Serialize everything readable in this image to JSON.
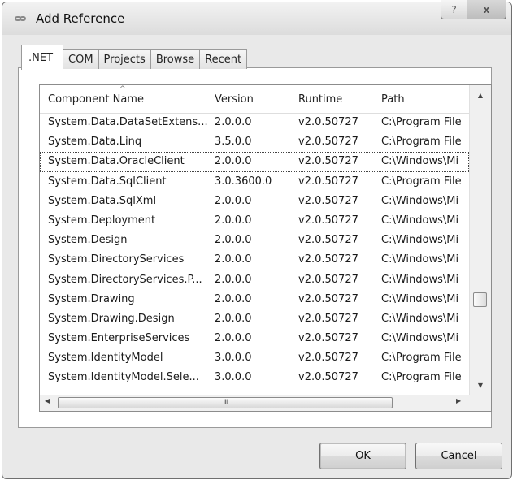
{
  "window": {
    "title": "Add Reference",
    "help_label": "?",
    "close_label": "x"
  },
  "tabs": [
    {
      "label": ".NET",
      "active": true
    },
    {
      "label": "COM",
      "active": false
    },
    {
      "label": "Projects",
      "active": false
    },
    {
      "label": "Browse",
      "active": false
    },
    {
      "label": "Recent",
      "active": false
    }
  ],
  "list": {
    "columns": [
      "Component Name",
      "Version",
      "Runtime",
      "Path"
    ],
    "sort_indicator": "^",
    "rows": [
      {
        "name": "System.Data.DataSetExtens...",
        "version": "2.0.0.0",
        "runtime": "v2.0.50727",
        "path": "C:\\Program File"
      },
      {
        "name": "System.Data.Linq",
        "version": "3.5.0.0",
        "runtime": "v2.0.50727",
        "path": "C:\\Program File"
      },
      {
        "name": "System.Data.OracleClient",
        "version": "2.0.0.0",
        "runtime": "v2.0.50727",
        "path": "C:\\Windows\\Mi"
      },
      {
        "name": "System.Data.SqlClient",
        "version": "3.0.3600.0",
        "runtime": "v2.0.50727",
        "path": "C:\\Program File"
      },
      {
        "name": "System.Data.SqlXml",
        "version": "2.0.0.0",
        "runtime": "v2.0.50727",
        "path": "C:\\Windows\\Mi"
      },
      {
        "name": "System.Deployment",
        "version": "2.0.0.0",
        "runtime": "v2.0.50727",
        "path": "C:\\Windows\\Mi"
      },
      {
        "name": "System.Design",
        "version": "2.0.0.0",
        "runtime": "v2.0.50727",
        "path": "C:\\Windows\\Mi"
      },
      {
        "name": "System.DirectoryServices",
        "version": "2.0.0.0",
        "runtime": "v2.0.50727",
        "path": "C:\\Windows\\Mi"
      },
      {
        "name": "System.DirectoryServices.P...",
        "version": "2.0.0.0",
        "runtime": "v2.0.50727",
        "path": "C:\\Windows\\Mi"
      },
      {
        "name": "System.Drawing",
        "version": "2.0.0.0",
        "runtime": "v2.0.50727",
        "path": "C:\\Windows\\Mi"
      },
      {
        "name": "System.Drawing.Design",
        "version": "2.0.0.0",
        "runtime": "v2.0.50727",
        "path": "C:\\Windows\\Mi"
      },
      {
        "name": "System.EnterpriseServices",
        "version": "2.0.0.0",
        "runtime": "v2.0.50727",
        "path": "C:\\Windows\\Mi"
      },
      {
        "name": "System.IdentityModel",
        "version": "3.0.0.0",
        "runtime": "v2.0.50727",
        "path": "C:\\Program File"
      },
      {
        "name": "System.IdentityModel.Sele...",
        "version": "3.0.0.0",
        "runtime": "v2.0.50727",
        "path": "C:\\Program File"
      }
    ],
    "focused_row_index": 2,
    "horizontal_scroll_thumb_grip": "III"
  },
  "buttons": {
    "ok": "OK",
    "cancel": "Cancel"
  }
}
